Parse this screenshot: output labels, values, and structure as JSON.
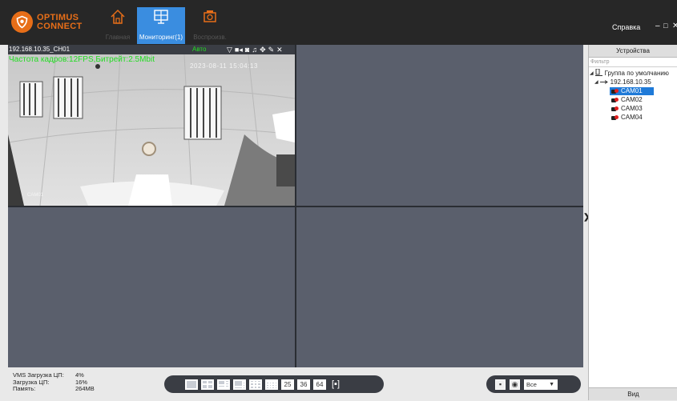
{
  "app": {
    "logo_line1": "OPTIMUS",
    "logo_line2": "CONNECT",
    "accent": "#e76e18",
    "selected_blue": "#3a8de0"
  },
  "nav": [
    {
      "label": "Главная",
      "icon": "home-icon"
    },
    {
      "label": "Мониторинг(1)",
      "icon": "monitor-icon"
    },
    {
      "label": "Воспроизв.",
      "icon": "playback-icon"
    }
  ],
  "header": {
    "help": "Справка",
    "minimize": "–",
    "maximize": "□",
    "close": "✕"
  },
  "video": {
    "channel_title": "192.168.10.35_CH01",
    "stream_mode": "Авто",
    "info_overlay": "Частота кадров:12FPS,Битрейт:2.5Mbit",
    "timestamp": "2023-08-11 15:04:13",
    "camera_label": "CAM01",
    "toolbar": [
      "▽",
      "■◂",
      "◙",
      "♫",
      "✥",
      "✎",
      "✕"
    ]
  },
  "devices": {
    "header": "Устройства",
    "filter_placeholder": "Фильтр",
    "group": "Группа по умолчанию",
    "device": "192.168.10.35",
    "cameras": [
      "CAM01",
      "CAM02",
      "CAM03",
      "CAM04"
    ],
    "selected_camera": "CAM01",
    "footer": "Вид"
  },
  "stats": {
    "vms_cpu_label": "VMS Загрузка ЦП:",
    "vms_cpu_value": "4%",
    "cpu_label": "Загрузка ЦП:",
    "cpu_value": "16%",
    "mem_label": "Память:",
    "mem_value": "264MB"
  },
  "layouts": {
    "num_25": "25",
    "num_36": "36",
    "num_64": "64",
    "fullscreen": "[▪]"
  },
  "controls": {
    "window_select": "Все",
    "dropdown_arrow": "▼"
  }
}
